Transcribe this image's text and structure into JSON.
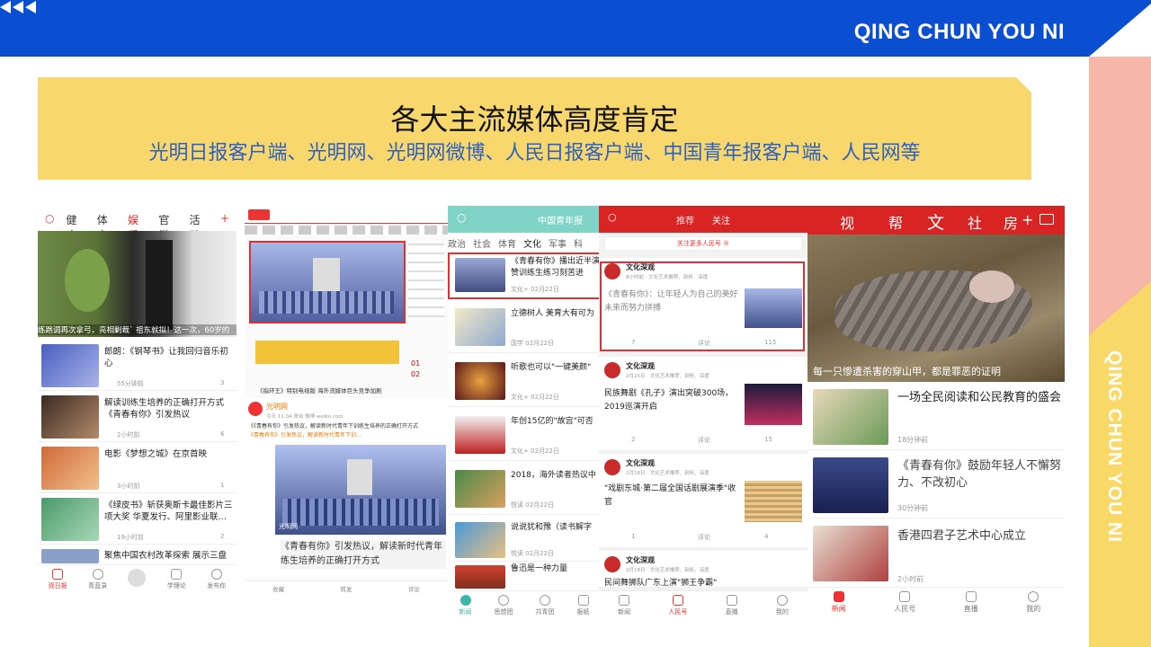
{
  "header": {
    "brand": "QING CHUN YOU NI",
    "side_text": "QING CHUN YOU NI"
  },
  "banner": {
    "title": "各大主流媒体高度肯定",
    "subtitle": "光明日报客户端、光明网、光明网微博、人民日报客户端、中国青年报客户端、人民网等"
  },
  "colors": {
    "blue": "#0a4fd2",
    "yellow": "#f8d86c",
    "pink": "#f6b6a8",
    "red": "#e03030",
    "teal": "#7fd3c7"
  },
  "shot1": {
    "tabs": [
      "健康",
      "体育",
      "娱乐",
      "官微",
      "活动"
    ],
    "active_tab": "娱乐",
    "caption": "练跑调再次拿弓，亮相剿裁` 祖东就拟！这一次，60岁的",
    "items": [
      {
        "title": "郎朗：《钢琴书》让我回归音乐初心",
        "time": "55分钟前",
        "likes": "3"
      },
      {
        "title": "解读训练生培养的正确打开方式《青春有你》引发热议",
        "time": "2小时前",
        "likes": "6"
      },
      {
        "title": "电影《梦想之城》在京首映",
        "time": "3小时前",
        "likes": "1"
      },
      {
        "title": "《绿皮书》斩获奥斯卡最佳影片三项大奖  华夏发行、阿里影业联…",
        "time": "19小时前",
        "likes": "2"
      },
      {
        "title": "聚焦中国农村改革探索 展示三盘",
        "time": "",
        "likes": ""
      }
    ],
    "nav": [
      "观日报",
      "青蓝录",
      "",
      "学理论",
      "发布你"
    ]
  },
  "shot2": {
    "headline": "《指环王》特别电视版 海外流媒体巨头竞争加剧",
    "weibo_name": "光明网",
    "weibo_meta": "今天 11:04 来自 微博 weibo.com",
    "weibo_text": "《《青春有你》引发热议，解读新时代青年下训练生培养的正确打开方式",
    "weibo_link": "《青春有你》引发热议，解读新时代青年下训...",
    "card_source": "光明网",
    "card_title": "《青春有你》引发热议，解读新时代青年练生培养的正确打开方式",
    "actions": [
      "收藏",
      "转发",
      "评论"
    ],
    "sections": [
      "01",
      "02"
    ]
  },
  "shot3": {
    "logo": "中国青年报",
    "tabs": [
      "政治",
      "社会",
      "体育",
      "文化",
      "军事",
      "科"
    ],
    "active_tab": "文化",
    "items": [
      {
        "title": "《青春有你》播出近半演赞训练生练习刻苦进",
        "tag": "文化+",
        "date": "02月22日"
      },
      {
        "title": "立德树人 美育大有可为",
        "tag": "国学",
        "date": "02月22日"
      },
      {
        "title": "听歌也可以\"一键美颜\"",
        "tag": "文化+",
        "date": "02月22日"
      },
      {
        "title": "年创15亿的\"故宫\"可否",
        "tag": "文化+",
        "date": "02月22日"
      },
      {
        "title": "2018，海外读者热议中",
        "tag": "悦读",
        "date": "02月22日"
      },
      {
        "title": "说说犹和豫（读书解字",
        "tag": "悦读",
        "date": "02月22日"
      },
      {
        "title": "鲁迅是一种力量",
        "tag": "",
        "date": ""
      }
    ],
    "nav": [
      "新闻",
      "思想团",
      "共青团",
      "报纸"
    ]
  },
  "shot4": {
    "tabs": [
      "推荐",
      "关注"
    ],
    "follow_banner": "关注更多人民号 ®",
    "cards": [
      {
        "author": "文化深观",
        "meta": "8小时前 · 文化艺术推荐、剖析、深度",
        "text": "《青春有你》：让年轻人为自己的美好未来而努力拼搏",
        "share": "7",
        "comment": "评论",
        "like": "115"
      },
      {
        "author": "文化深观",
        "meta": "2月25日 · 文化艺术推荐、剖析、深度",
        "text": "民族舞剧《孔子》演出突破300场，2019巡演开启",
        "share": "2",
        "comment": "评论",
        "like": "15"
      },
      {
        "author": "文化深观",
        "meta": "2月18日 · 文化艺术推荐、剖析、深度",
        "text": "\"戏剧东城·第二届全国话剧展演季\"收官",
        "share": "1",
        "comment": "评论",
        "like": "4"
      },
      {
        "author": "文化深观",
        "meta": "2月18日 · 文化艺术推荐、剖析、深度",
        "text": "民间舞狮队广东上演\"狮王争霸\"",
        "share": "",
        "comment": "",
        "like": ""
      }
    ],
    "nav": [
      "新闻",
      "人民号",
      "直播",
      "我的"
    ]
  },
  "shot5": {
    "tabs": [
      "视",
      "帮",
      "文",
      "社",
      "房"
    ],
    "hero_caption": "每一只惨遭杀害的穿山甲，都是罪恶的证明",
    "items": [
      {
        "title": "一场全民阅读和公民教育的盛会",
        "time": "18分钟前"
      },
      {
        "title": "《青春有你》鼓励年轻人不懈努力、不改初心",
        "time": "30分钟前"
      },
      {
        "title": "香港四君子艺术中心成立",
        "time": "2小时前"
      }
    ],
    "nav": [
      "新闻",
      "人民号",
      "直播",
      "我的"
    ]
  }
}
